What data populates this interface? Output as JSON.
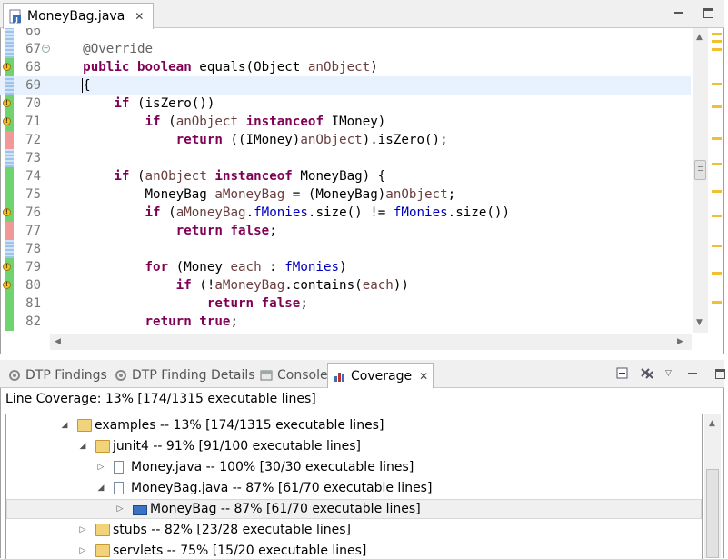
{
  "editor": {
    "tab_title": "MoneyBag.java",
    "lines": [
      {
        "num": "66",
        "code": ""
      },
      {
        "num": "67",
        "code": "    @Override"
      },
      {
        "num": "68",
        "code": "    public boolean equals(Object anObject)"
      },
      {
        "num": "69",
        "code": "    {"
      },
      {
        "num": "70",
        "code": "        if (isZero())"
      },
      {
        "num": "71",
        "code": "            if (anObject instanceof IMoney)"
      },
      {
        "num": "72",
        "code": "                return ((IMoney)anObject).isZero();"
      },
      {
        "num": "73",
        "code": ""
      },
      {
        "num": "74",
        "code": "        if (anObject instanceof MoneyBag) {"
      },
      {
        "num": "75",
        "code": "            MoneyBag aMoneyBag = (MoneyBag)anObject;"
      },
      {
        "num": "76",
        "code": "            if (aMoneyBag.fMonies.size() != fMonies.size())"
      },
      {
        "num": "77",
        "code": "                return false;"
      },
      {
        "num": "78",
        "code": ""
      },
      {
        "num": "79",
        "code": "            for (Money each : fMonies)"
      },
      {
        "num": "80",
        "code": "                if (!aMoneyBag.contains(each))"
      },
      {
        "num": "81",
        "code": "                    return false;"
      },
      {
        "num": "82",
        "code": "            return true;"
      }
    ]
  },
  "view": {
    "tabs": [
      {
        "label": "DTP Findings",
        "icon": "dtp-findings-icon"
      },
      {
        "label": "DTP Finding Details",
        "icon": "dtp-details-icon"
      },
      {
        "label": "Console",
        "icon": "console-icon"
      },
      {
        "label": "Coverage",
        "icon": "coverage-icon",
        "active": true
      }
    ],
    "summary": "Line Coverage: 13% [174/1315 executable lines]",
    "tree": [
      {
        "label": "examples -- 13% [174/1315 executable lines]",
        "icon": "folder-open-icon",
        "expanded": true
      },
      {
        "label": "junit4 -- 91% [91/100 executable lines]",
        "icon": "folder-open-icon",
        "expanded": true
      },
      {
        "label": "Money.java -- 100% [30/30 executable lines]",
        "icon": "java-file-icon",
        "expanded": false
      },
      {
        "label": "MoneyBag.java -- 87% [61/70 executable lines]",
        "icon": "java-file-icon",
        "expanded": true
      },
      {
        "label": "MoneyBag -- 87% [61/70 executable lines]",
        "icon": "class-icon",
        "expanded": false,
        "selected": true
      },
      {
        "label": "stubs -- 82% [23/28 executable lines]",
        "icon": "folder-icon",
        "expanded": false
      },
      {
        "label": "servlets -- 75% [15/20 executable lines]",
        "icon": "folder-icon",
        "expanded": false
      }
    ]
  }
}
